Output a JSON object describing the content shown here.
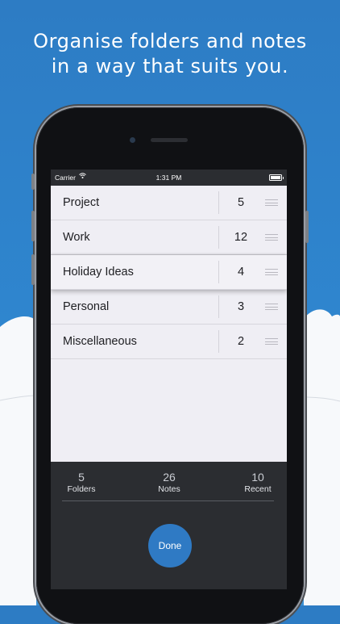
{
  "headline": {
    "line1": "Organise folders and notes",
    "line2": "in a way that suits you."
  },
  "status_bar": {
    "carrier": "Carrier",
    "time": "1:31 PM",
    "icons": [
      "wifi-icon",
      "battery-icon"
    ]
  },
  "folders": [
    {
      "name": "Project",
      "count": "5"
    },
    {
      "name": "Work",
      "count": "12"
    },
    {
      "name": "Holiday Ideas",
      "count": "4",
      "state": "dragging"
    },
    {
      "name": "Personal",
      "count": "3"
    },
    {
      "name": "Miscellaneous",
      "count": "2"
    }
  ],
  "summary": {
    "folders": {
      "value": "5",
      "label": "Folders"
    },
    "notes": {
      "value": "26",
      "label": "Notes"
    },
    "recent": {
      "value": "10",
      "label": "Recent"
    }
  },
  "done_label": "Done",
  "colors": {
    "background_blue": "#2f86cf",
    "accent_blue": "#2f7ac4",
    "dark_panel": "#2b2d31",
    "list_background": "#efeef4"
  }
}
